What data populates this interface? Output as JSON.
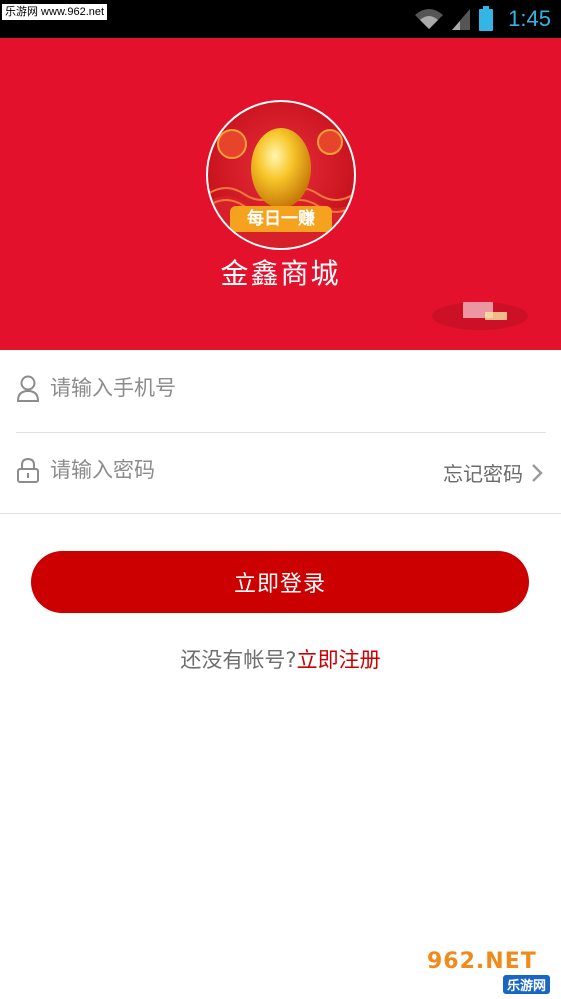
{
  "status_bar": {
    "watermark": "乐游网 www.962.net",
    "time": "1:45"
  },
  "header": {
    "app_name": "金鑫商城",
    "logo_caption": "每日一赚"
  },
  "form": {
    "phone_placeholder": "请输入手机号",
    "password_placeholder": "请输入密码",
    "forgot_label": "忘记密码"
  },
  "login_button": "立即登录",
  "register": {
    "prompt": "还没有帐号?",
    "link": "立即注册"
  },
  "watermark_bottom": {
    "top": "962.NET",
    "bottom": "乐游网"
  },
  "colors": {
    "brand_red": "#e3112c",
    "button_red": "#cc0000",
    "clock_blue": "#33b5e5"
  }
}
